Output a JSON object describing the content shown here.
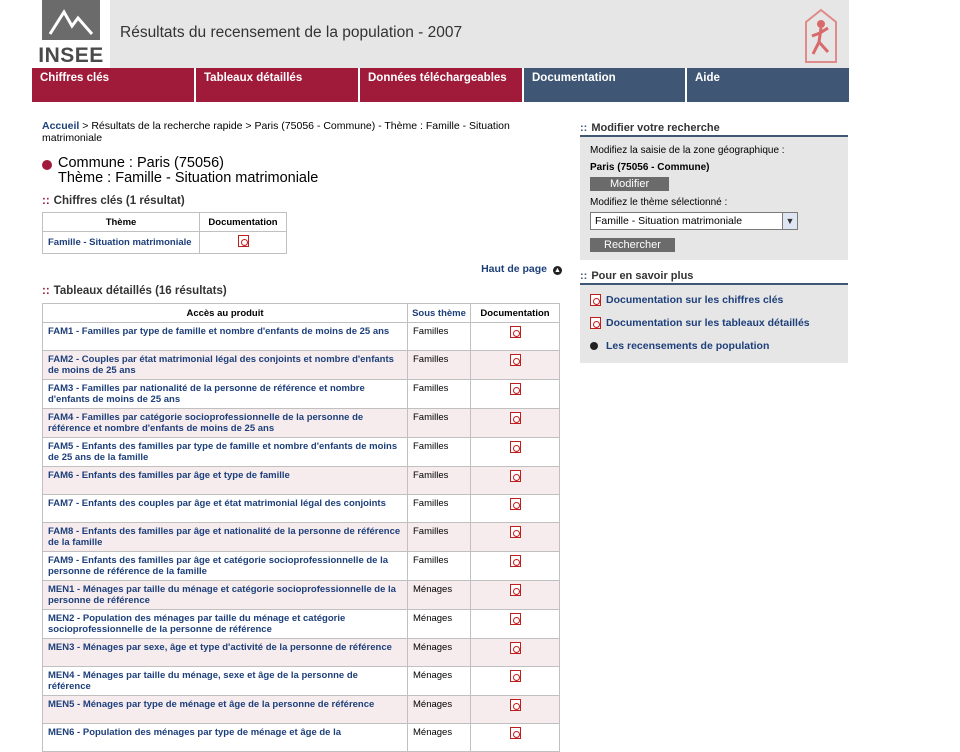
{
  "header": {
    "logo_text": "INSEE",
    "title": "Résultats du recensement de la population - 2007"
  },
  "nav": [
    {
      "label": "Chiffres clés",
      "color": "#a01b3a"
    },
    {
      "label": "Tableaux détaillés",
      "color": "#a01b3a"
    },
    {
      "label": "Données téléchargeables",
      "color": "#a01b3a"
    },
    {
      "label": "Documentation",
      "color": "#3f5775"
    },
    {
      "label": "Aide",
      "color": "#3f5775"
    }
  ],
  "breadcrumb": {
    "home": "Accueil",
    "rest": " > Résultats de la recherche rapide > Paris (75056 - Commune) - Thème : Famille - Situation matrimoniale"
  },
  "commune": {
    "line1": "Commune : Paris (75056)",
    "line2": "Thème : Famille - Situation matrimoniale"
  },
  "chiffres": {
    "title": "Chiffres clés (1 résultat)",
    "headers": [
      "Thème",
      "Documentation"
    ],
    "row": "Famille - Situation matrimoniale"
  },
  "haut_de_page": "Haut de page",
  "tableaux": {
    "title": "Tableaux détaillés (16 résultats)",
    "headers": [
      "Accès au produit",
      "Sous thème",
      "Documentation"
    ],
    "rows": [
      {
        "code": "FAM1",
        "text": "Familles par type de famille et nombre d'enfants de moins de 25 ans",
        "theme": "Familles"
      },
      {
        "code": "FAM2",
        "text": "Couples par état matrimonial légal des conjoints et nombre d'enfants de moins de 25 ans",
        "theme": "Familles"
      },
      {
        "code": "FAM3",
        "text": "Familles par nationalité de la personne de référence et nombre d'enfants de moins de 25 ans",
        "theme": "Familles"
      },
      {
        "code": "FAM4",
        "text": "Familles par catégorie socioprofessionnelle de la personne de référence et nombre d'enfants de moins de 25 ans",
        "theme": "Familles"
      },
      {
        "code": "FAM5",
        "text": "Enfants des familles par type de famille et nombre d'enfants de moins de 25 ans de la famille",
        "theme": "Familles"
      },
      {
        "code": "FAM6",
        "text": "Enfants des familles par âge et type de famille",
        "theme": "Familles"
      },
      {
        "code": "FAM7",
        "text": "Enfants des couples par âge et état matrimonial légal des conjoints",
        "theme": "Familles"
      },
      {
        "code": "FAM8",
        "text": "Enfants des familles par âge et nationalité de la personne de référence de la famille",
        "theme": "Familles"
      },
      {
        "code": "FAM9",
        "text": "Enfants des familles par âge et catégorie socioprofessionnelle de la personne de référence de la famille",
        "theme": "Familles"
      },
      {
        "code": "MEN1",
        "text": "Ménages par taille du ménage et catégorie socioprofessionnelle de la personne de référence",
        "theme": "Ménages"
      },
      {
        "code": "MEN2",
        "text": "Population des ménages par taille du ménage et catégorie socioprofessionnelle de la personne de référence",
        "theme": "Ménages"
      },
      {
        "code": "MEN3",
        "text": "Ménages par sexe, âge et type d'activité de la personne de référence",
        "theme": "Ménages"
      },
      {
        "code": "MEN4",
        "text": "Ménages par taille du ménage, sexe et âge de la personne de référence",
        "theme": "Ménages"
      },
      {
        "code": "MEN5",
        "text": "Ménages par type de ménage et âge de la personne de référence",
        "theme": "Ménages"
      },
      {
        "code": "MEN6",
        "text": "Population des ménages par type de ménage et âge de la",
        "theme": "Ménages"
      }
    ]
  },
  "modifier": {
    "title": "Modifier votre recherche",
    "zone_label": "Modifiez la saisie de la zone géographique :",
    "zone_value": "Paris (75056 - Commune)",
    "modifier_button": "Modifier",
    "theme_label": "Modifiez le thème sélectionné :",
    "theme_selected": "Famille - Situation matrimoniale",
    "search_button": "Rechercher"
  },
  "savoir": {
    "title": "Pour en savoir plus",
    "links": [
      {
        "label": "Documentation sur les chiffres clés",
        "icon": "pdf-icon"
      },
      {
        "label": "Documentation sur les tableaux détaillés",
        "icon": "pdf-icon"
      },
      {
        "label": "Les recensements de population",
        "icon": "arrow-bullet-icon"
      }
    ]
  }
}
